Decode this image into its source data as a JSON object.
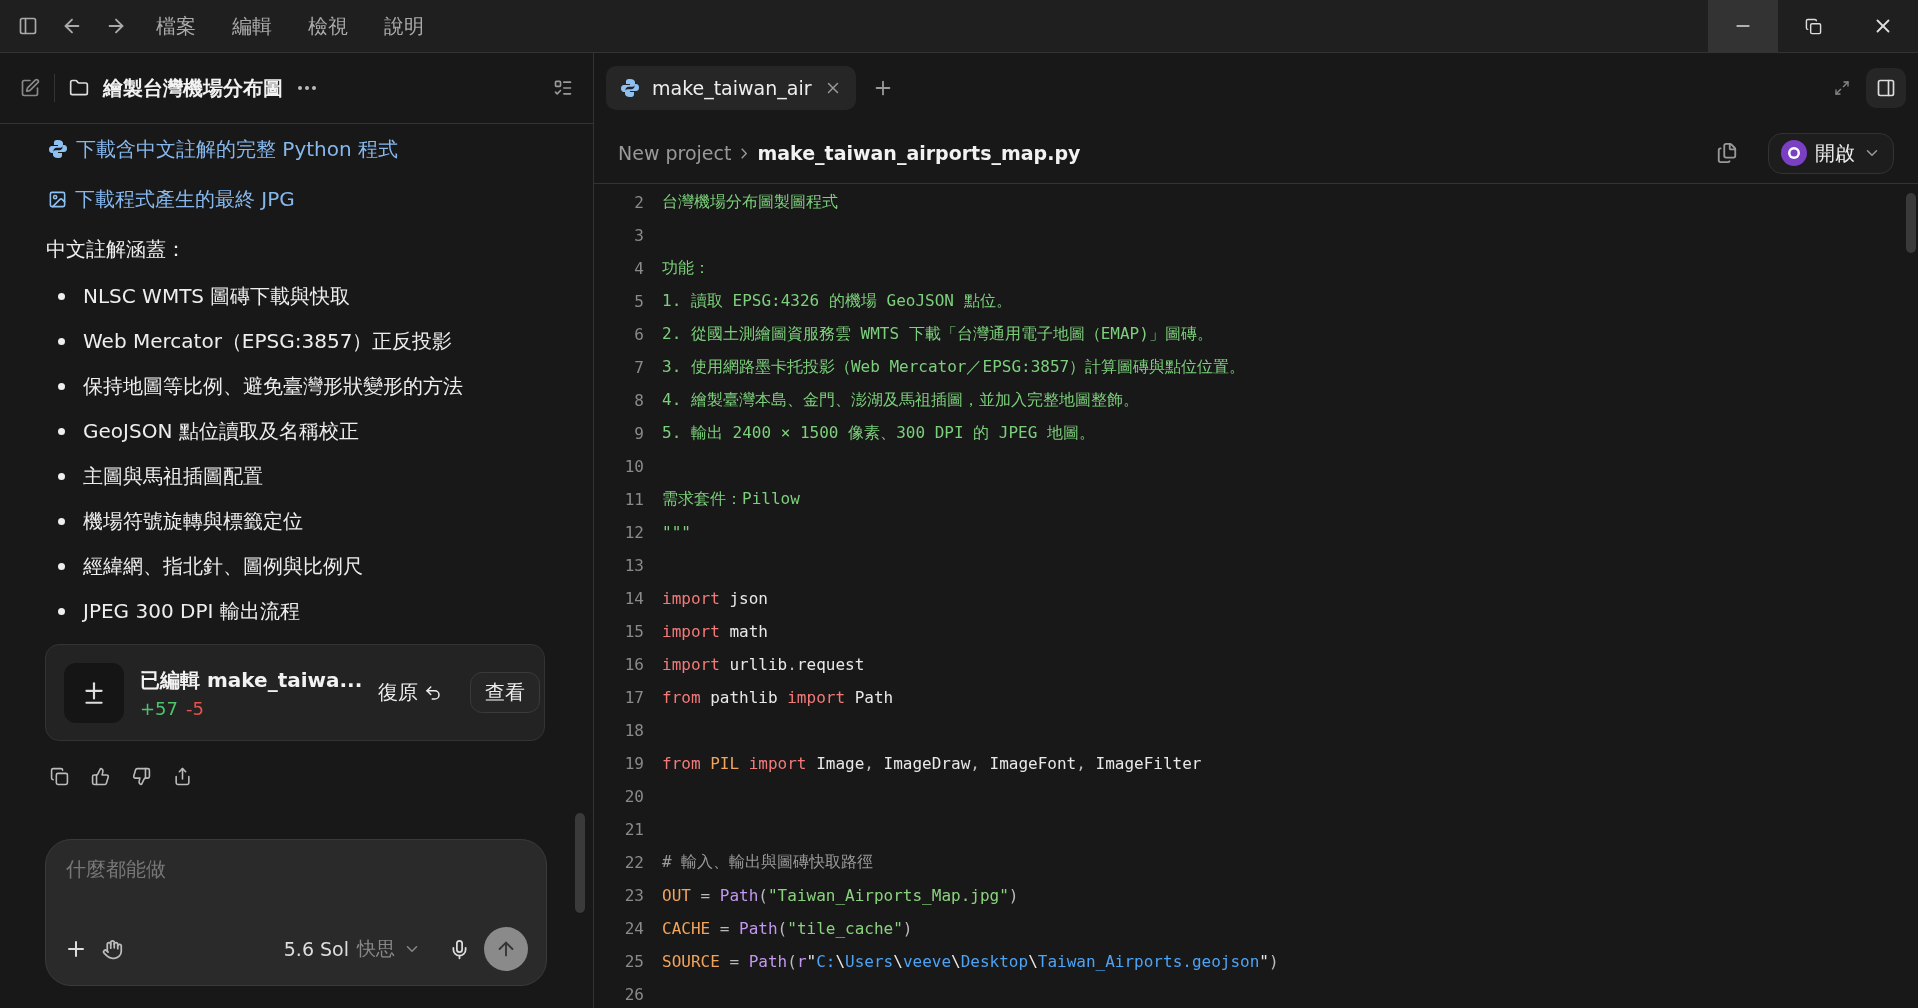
{
  "menu": [
    "檔案",
    "編輯",
    "檢視",
    "說明"
  ],
  "chat": {
    "title": "繪製台灣機場分布圖",
    "links": [
      {
        "kind": "python",
        "text": "下載含中文註解的完整 Python 程式"
      },
      {
        "kind": "image",
        "text": "下載程式產生的最終 JPG"
      }
    ],
    "heading": "中文註解涵蓋：",
    "bullets": [
      "NLSC WMTS 圖磚下載與快取",
      "Web Mercator（EPSG:3857）正反投影",
      "保持地圖等比例、避免臺灣形狀變形的方法",
      "GeoJSON 點位讀取及名稱校正",
      "主圖與馬祖插圖配置",
      "機場符號旋轉與標籤定位",
      "經緯網、指北針、圖例與比例尺",
      "JPEG 300 DPI 輸出流程"
    ],
    "edit_card": {
      "title": "已編輯 make_taiwa...",
      "added": "+57",
      "removed": "-5",
      "revert": "復原",
      "view": "查看"
    },
    "composer": {
      "placeholder": "什麼都能做",
      "model": "5.6 Sol",
      "mode": "快思"
    }
  },
  "editor": {
    "tabs": [
      {
        "label": "make_taiwan_air",
        "selected": true
      }
    ],
    "breadcrumb": [
      "New project",
      "make_taiwan_airports_map.py"
    ],
    "open_button": "開啟",
    "lines": [
      {
        "n": "2",
        "tokens": [
          {
            "kind": "doc",
            "text": "台灣機場分布圖製圖程式"
          }
        ]
      },
      {
        "n": "3"
      },
      {
        "n": "4",
        "tokens": [
          {
            "kind": "doc",
            "text": "功能："
          }
        ]
      },
      {
        "n": "5",
        "tokens": [
          {
            "kind": "doc",
            "text": "1. 讀取 EPSG:4326 的機場 GeoJSON 點位。"
          }
        ]
      },
      {
        "n": "6",
        "tokens": [
          {
            "kind": "doc",
            "text": "2. 從國土測繪圖資服務雲 WMTS 下載「台灣通用電子地圖（EMAP)」圖磚。"
          }
        ]
      },
      {
        "n": "7",
        "tokens": [
          {
            "kind": "doc",
            "text": "3. 使用網路墨卡托投影（Web Mercator／EPSG:3857）計算圖磚與點位位置。"
          }
        ]
      },
      {
        "n": "8",
        "tokens": [
          {
            "kind": "doc",
            "text": "4. 繪製臺灣本島、金門、澎湖及馬祖插圖，並加入完整地圖整飾。"
          }
        ]
      },
      {
        "n": "9",
        "tokens": [
          {
            "kind": "doc",
            "text": "5. 輸出 2400 × 1500 像素、300 DPI 的 JPEG 地圖。"
          }
        ]
      },
      {
        "n": "10"
      },
      {
        "n": "11",
        "tokens": [
          {
            "kind": "doc",
            "text": "需求套件：Pillow"
          }
        ]
      },
      {
        "n": "12",
        "tokens": [
          {
            "kind": "doc",
            "text": "\"\"\""
          }
        ]
      },
      {
        "n": "13"
      },
      {
        "n": "14",
        "tokens": [
          {
            "kind": "kw",
            "text": "import"
          },
          {
            "kind": "plain",
            "text": " json"
          }
        ]
      },
      {
        "n": "15",
        "tokens": [
          {
            "kind": "kw",
            "text": "import"
          },
          {
            "kind": "plain",
            "text": " math"
          }
        ]
      },
      {
        "n": "16",
        "tokens": [
          {
            "kind": "kw",
            "text": "import"
          },
          {
            "kind": "plain",
            "text": " urllib"
          },
          {
            "kind": "punct",
            "text": "."
          },
          {
            "kind": "plain",
            "text": "request"
          }
        ]
      },
      {
        "n": "17",
        "tokens": [
          {
            "kind": "kw",
            "text": "from"
          },
          {
            "kind": "plain",
            "text": " pathlib "
          },
          {
            "kind": "kw",
            "text": "import"
          },
          {
            "kind": "plain",
            "text": " Path"
          }
        ]
      },
      {
        "n": "18"
      },
      {
        "n": "19",
        "tokens": [
          {
            "kind": "kw",
            "text": "from"
          },
          {
            "kind": "const",
            "text": " PIL "
          },
          {
            "kind": "kw",
            "text": "import"
          },
          {
            "kind": "plain",
            "text": " Image"
          },
          {
            "kind": "punct",
            "text": ", "
          },
          {
            "kind": "plain",
            "text": "ImageDraw"
          },
          {
            "kind": "punct",
            "text": ", "
          },
          {
            "kind": "plain",
            "text": "ImageFont"
          },
          {
            "kind": "punct",
            "text": ", "
          },
          {
            "kind": "plain",
            "text": "ImageFilter"
          }
        ]
      },
      {
        "n": "20"
      },
      {
        "n": "21"
      },
      {
        "n": "22",
        "tokens": [
          {
            "kind": "comment",
            "text": "# 輸入、輸出與圖磚快取路徑"
          }
        ]
      },
      {
        "n": "23",
        "tokens": [
          {
            "kind": "const",
            "text": "OUT"
          },
          {
            "kind": "punct",
            "text": " = "
          },
          {
            "kind": "func",
            "text": "Path"
          },
          {
            "kind": "punct",
            "text": "("
          },
          {
            "kind": "str",
            "text": "\"Taiwan_Airports_Map.jpg\""
          },
          {
            "kind": "punct",
            "text": ")"
          }
        ]
      },
      {
        "n": "24",
        "tokens": [
          {
            "kind": "const",
            "text": "CACHE"
          },
          {
            "kind": "punct",
            "text": " = "
          },
          {
            "kind": "func",
            "text": "Path"
          },
          {
            "kind": "punct",
            "text": "("
          },
          {
            "kind": "str",
            "text": "\"tile_cache\""
          },
          {
            "kind": "punct",
            "text": ")"
          }
        ]
      },
      {
        "n": "25",
        "tokens": [
          {
            "kind": "const",
            "text": "SOURCE"
          },
          {
            "kind": "punct",
            "text": " = "
          },
          {
            "kind": "func",
            "text": "Path"
          },
          {
            "kind": "punct",
            "text": "("
          },
          {
            "kind": "func",
            "text": "r"
          },
          {
            "kind": "plain",
            "text": "\""
          },
          {
            "kind": "path",
            "text": "C:"
          },
          {
            "kind": "plain",
            "text": "\\"
          },
          {
            "kind": "path",
            "text": "Users"
          },
          {
            "kind": "plain",
            "text": "\\"
          },
          {
            "kind": "path",
            "text": "veeve"
          },
          {
            "kind": "plain",
            "text": "\\"
          },
          {
            "kind": "path",
            "text": "Desktop"
          },
          {
            "kind": "plain",
            "text": "\\"
          },
          {
            "kind": "path",
            "text": "Taiwan_Airports.geojson"
          },
          {
            "kind": "plain",
            "text": "\""
          },
          {
            "kind": "punct",
            "text": ")"
          }
        ]
      },
      {
        "n": "26"
      }
    ]
  }
}
